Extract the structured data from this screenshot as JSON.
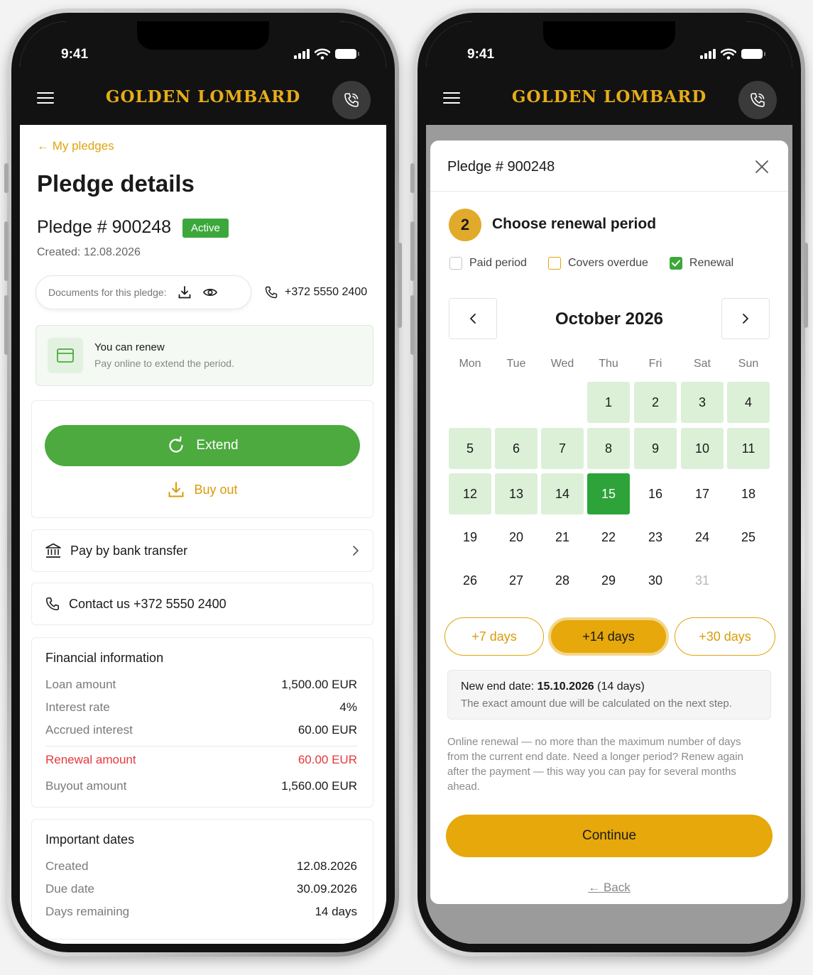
{
  "status_bar": {
    "time": "9:41"
  },
  "brand": "GOLDEN LOMBARD",
  "left": {
    "back_link": "← My pledges",
    "title": "Pledge details",
    "pledge": "Pledge # 900248",
    "status_badge": "Active",
    "created": "Created: 12.08.2026",
    "documents_label": "Documents for this pledge:",
    "phone": "+372 5550 2400",
    "renew_title": "You can renew",
    "renew_sub": "Pay online to extend the period.",
    "extend_label": "Extend",
    "buyout_label": "Buy out",
    "bank_transfer": "Pay by bank transfer",
    "contact": "Contact us +372 5550 2400",
    "financial": {
      "title": "Financial information",
      "rows": [
        {
          "k": "Loan amount",
          "v": "1,500.00 EUR"
        },
        {
          "k": "Interest rate",
          "v": "4%"
        },
        {
          "k": "Accrued interest",
          "v": "60.00 EUR"
        },
        {
          "k": "Renewal amount",
          "v": "60.00 EUR"
        },
        {
          "k": "Buyout amount",
          "v": "1,560.00 EUR"
        }
      ]
    },
    "dates": {
      "title": "Important dates",
      "rows": [
        {
          "k": "Created",
          "v": "12.08.2026"
        },
        {
          "k": "Due date",
          "v": "30.09.2026"
        },
        {
          "k": "Days remaining",
          "v": "14 days"
        }
      ]
    }
  },
  "right": {
    "modal_title": "Pledge # 900248",
    "step_number": "2",
    "step_title": "Choose renewal period",
    "checks": [
      {
        "label": "Paid period",
        "checked": false
      },
      {
        "label": "Covers overdue",
        "checked": false
      },
      {
        "label": "Renewal",
        "checked": true
      }
    ],
    "month": "October 2026",
    "weekdays": [
      "Mon",
      "Tue",
      "Wed",
      "Thu",
      "Fri",
      "Sat",
      "Sun"
    ],
    "days": [
      "1",
      "2",
      "3",
      "4",
      "5",
      "6",
      "7",
      "8",
      "9",
      "10",
      "11",
      "12",
      "13",
      "14",
      "15",
      "16",
      "17",
      "18",
      "19",
      "20",
      "21",
      "22",
      "23",
      "24",
      "25",
      "26",
      "27",
      "28",
      "29",
      "30",
      "31"
    ],
    "highlighted_through": 15,
    "selected_day": 15,
    "disabled_day": 31,
    "quick_options": [
      "+7 days",
      "+14 days",
      "+30 days"
    ],
    "selected_option": "+14 days",
    "new_end_label": "New end date: ",
    "new_end_date": "15.10.2026",
    "new_end_suffix": " (14 days)",
    "info_note": "The exact amount due will be calculated on the next step.",
    "policy_note": "Online renewal — no more than the maximum number of days from the current end date. Need a longer period? Renew again after the payment — this way you can pay for several months ahead.",
    "continue_label": "Continue",
    "back_label": "← Back"
  },
  "colors": {
    "accent": "#e6a80a",
    "brand_gold": "#e6ad18",
    "success": "#4caa3f",
    "danger": "#e5383b"
  }
}
